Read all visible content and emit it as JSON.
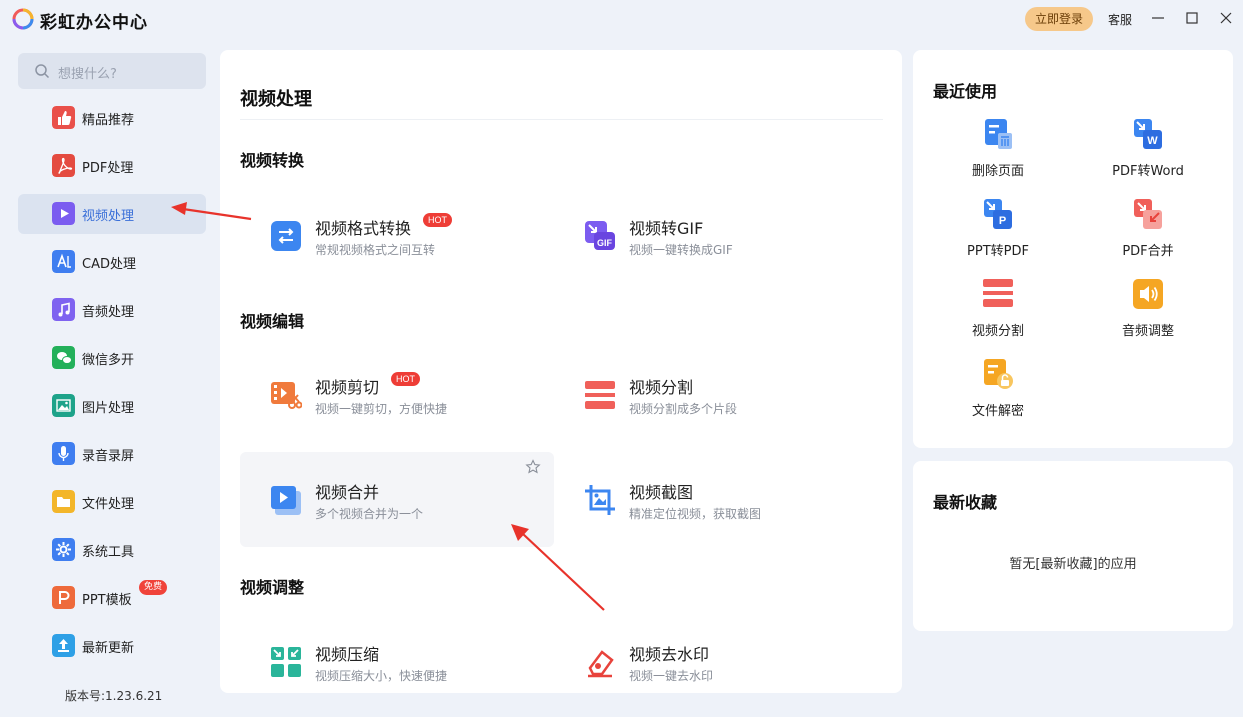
{
  "app": {
    "title": "彩虹办公中心"
  },
  "titlebar": {
    "login_label": "立即登录",
    "service_label": "客服"
  },
  "search": {
    "placeholder": "想搜什么?"
  },
  "sidebar": {
    "items": [
      {
        "label": "精品推荐",
        "icon": "thumbs-up-icon",
        "color": "#e9504a"
      },
      {
        "label": "PDF处理",
        "icon": "pdf-icon",
        "color": "#e44b40"
      },
      {
        "label": "视频处理",
        "icon": "video-play-icon",
        "color": "#7b5cf0",
        "active": true
      },
      {
        "label": "CAD处理",
        "icon": "cad-icon",
        "color": "#3f7ef0"
      },
      {
        "label": "音频处理",
        "icon": "music-icon",
        "color": "#7f63f0"
      },
      {
        "label": "微信多开",
        "icon": "wechat-icon",
        "color": "#23b05a"
      },
      {
        "label": "图片处理",
        "icon": "image-icon",
        "color": "#1ea38a"
      },
      {
        "label": "录音录屏",
        "icon": "microphone-icon",
        "color": "#3f7ef0"
      },
      {
        "label": "文件处理",
        "icon": "folder-icon",
        "color": "#f3b62a"
      },
      {
        "label": "系统工具",
        "icon": "gear-icon",
        "color": "#3f7ef0"
      },
      {
        "label": "PPT模板",
        "icon": "ppt-icon",
        "color": "#ee6a3b",
        "badge": "免费"
      },
      {
        "label": "最新更新",
        "icon": "upload-icon",
        "color": "#2ea0e6"
      }
    ],
    "version": "版本号:1.23.6.21"
  },
  "main": {
    "title": "视频处理",
    "sections": [
      {
        "title": "视频转换"
      },
      {
        "title": "视频编辑"
      },
      {
        "title": "视频调整"
      }
    ],
    "cards": [
      {
        "title": "视频格式转换",
        "desc": "常规视频格式之间互转",
        "icon": "convert-arrows-icon",
        "badge": "HOT"
      },
      {
        "title": "视频转GIF",
        "desc": "视频一键转换成GIF",
        "icon": "gif-icon"
      },
      {
        "title": "视频剪切",
        "desc": "视频一键剪切，方便快捷",
        "icon": "scissors-film-icon",
        "badge": "HOT"
      },
      {
        "title": "视频分割",
        "desc": "视频分割成多个片段",
        "icon": "split-icon"
      },
      {
        "title": "视频合并",
        "desc": "多个视频合并为一个",
        "icon": "merge-video-icon"
      },
      {
        "title": "视频截图",
        "desc": "精准定位视频，获取截图",
        "icon": "crop-image-icon"
      },
      {
        "title": "视频压缩",
        "desc": "视频压缩大小，快速便捷",
        "icon": "compress-icon"
      },
      {
        "title": "视频去水印",
        "desc": "视频一键去水印",
        "icon": "eraser-icon"
      }
    ]
  },
  "recent": {
    "title": "最近使用",
    "items": [
      {
        "label": "删除页面",
        "icon": "delete-page-icon"
      },
      {
        "label": "PDF转Word",
        "icon": "pdf-to-word-icon"
      },
      {
        "label": "PPT转PDF",
        "icon": "ppt-to-pdf-icon"
      },
      {
        "label": "PDF合并",
        "icon": "pdf-merge-icon"
      },
      {
        "label": "视频分割",
        "icon": "split-icon"
      },
      {
        "label": "音频调整",
        "icon": "speaker-icon"
      },
      {
        "label": "文件解密",
        "icon": "unlock-file-icon"
      }
    ]
  },
  "favorites": {
    "title": "最新收藏",
    "empty_text": "暂无[最新收藏]的应用"
  },
  "colors": {
    "accent": "#3a6fd8",
    "hot": "#ee3d36",
    "login": "#f6c88a",
    "annotation_arrow": "#e8332b"
  }
}
